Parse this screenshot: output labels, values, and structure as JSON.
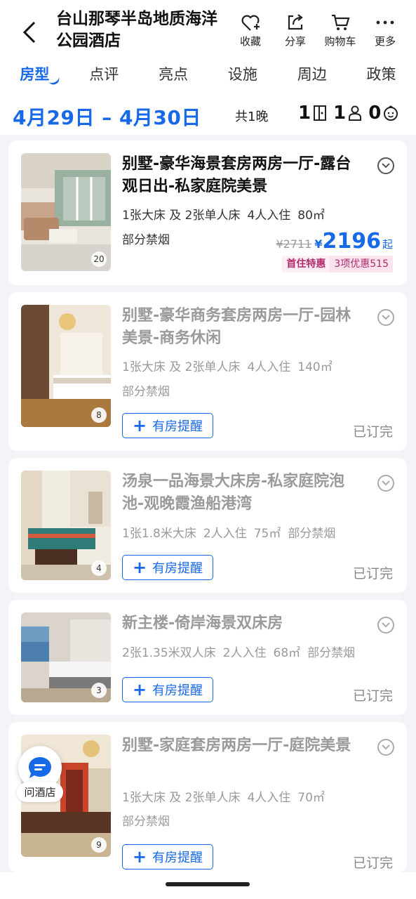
{
  "header": {
    "title": "台山那琴半岛地质海洋公园酒店",
    "actions": [
      {
        "label": "收藏",
        "icon": "heart-plus-icon"
      },
      {
        "label": "分享",
        "icon": "share-icon"
      },
      {
        "label": "购物车",
        "icon": "cart-icon"
      },
      {
        "label": "更多",
        "icon": "more-icon"
      }
    ]
  },
  "tabs": [
    "房型",
    "点评",
    "亮点",
    "设施",
    "周边",
    "政策"
  ],
  "datebar": {
    "dates": "4月29日 – 4月30日",
    "nights": "共1晚",
    "rooms": "1",
    "adults": "1",
    "children": "0"
  },
  "rooms": [
    {
      "name": "别墅-豪华海景套房两房一厅-露台观日出-私家庭院美景",
      "beds": "1张大床 及 2张单人床",
      "guests": "4人入住",
      "area": "80㎡",
      "smoking": "部分禁烟",
      "photo_count": "20",
      "original_price": "¥2711",
      "currency": "¥",
      "price": "2196",
      "price_suffix": "起",
      "promo_tag": "首住特惠",
      "promo_detail": "3项优惠515"
    },
    {
      "name": "别墅-豪华商务套房两房一厅-园林美景-商务休闲",
      "beds": "1张大床 及 2张单人床",
      "guests": "4人入住",
      "area": "140㎡",
      "smoking": "部分禁烟",
      "photo_count": "8",
      "remind": "有房提醒",
      "status": "已订完"
    },
    {
      "name": "汤泉一品海景大床房-私家庭院泡池-观晚霞渔船港湾",
      "beds": "1张1.8米大床",
      "guests": "2人入住",
      "area": "75㎡",
      "smoking": "部分禁烟",
      "photo_count": "4",
      "remind": "有房提醒",
      "status": "已订完"
    },
    {
      "name": "新主楼-倚岸海景双床房",
      "beds": "2张1.35米双人床",
      "guests": "2人入住",
      "area": "68㎡",
      "smoking": "部分禁烟",
      "photo_count": "3",
      "remind": "有房提醒",
      "status": "已订完"
    },
    {
      "name": "别墅-家庭套房两房一厅-庭院美景",
      "beds": "1张大床 及 2张单人床",
      "guests": "4人入住",
      "area": "70㎡",
      "smoking": "部分禁烟",
      "photo_count": "9",
      "remind": "有房提醒",
      "status": "已订完"
    }
  ],
  "ask_hotel": "问酒店",
  "colors": {
    "accent": "#1769e8",
    "promo": "#b22a6a",
    "muted": "#9a9a9a"
  }
}
